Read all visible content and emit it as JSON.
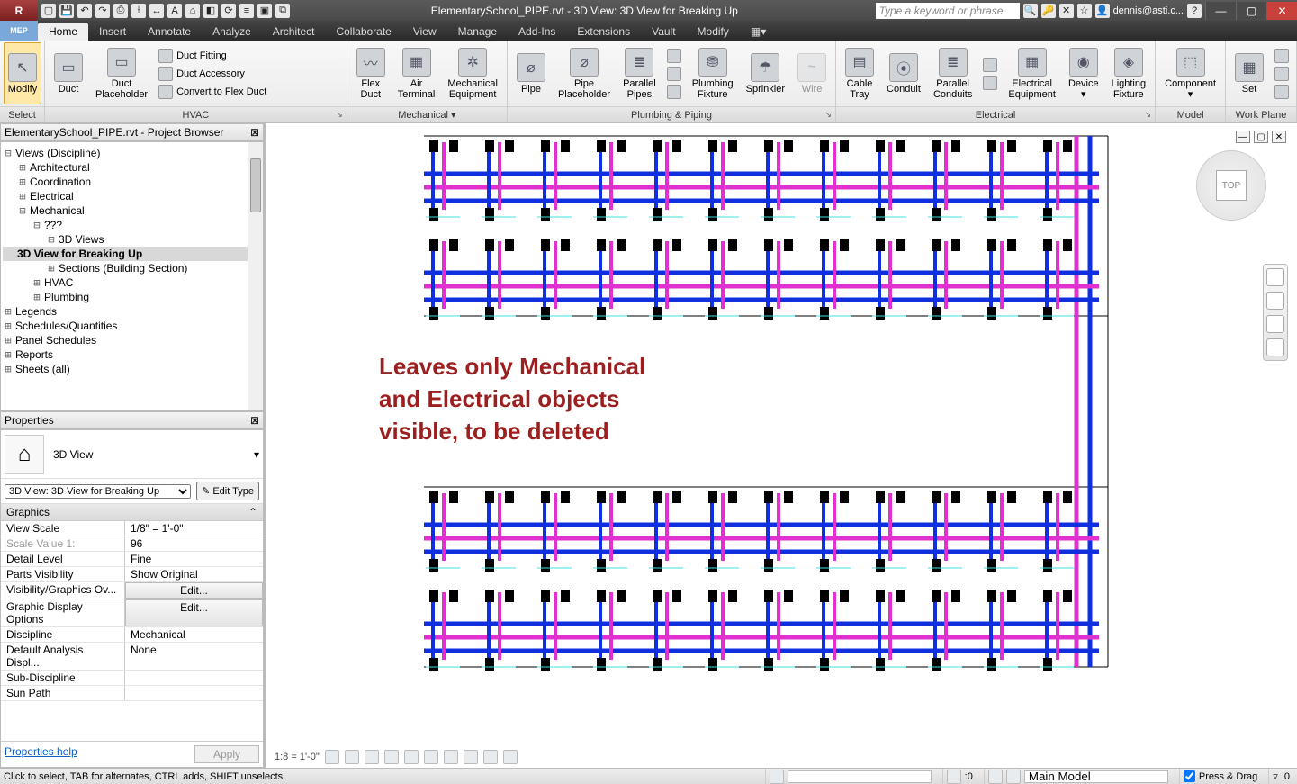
{
  "titlebar": {
    "app_badge": "R",
    "mep_badge": "MEP",
    "document_title": "ElementarySchool_PIPE.rvt - 3D View: 3D View for Breaking Up",
    "search_placeholder": "Type a keyword or phrase",
    "user": "dennis@asti.c...",
    "help_icon": "?"
  },
  "tabs": [
    "Home",
    "Insert",
    "Annotate",
    "Analyze",
    "Architect",
    "Collaborate",
    "View",
    "Manage",
    "Add-Ins",
    "Extensions",
    "Vault",
    "Modify"
  ],
  "active_tab": "Home",
  "ribbon": {
    "panels": [
      {
        "title": "Select",
        "items": [
          {
            "label": "Modify",
            "selected": true
          }
        ]
      },
      {
        "title": "HVAC",
        "items": [
          {
            "label": "Duct"
          },
          {
            "label": "Duct\nPlaceholder"
          }
        ],
        "small": [
          "Duct Fitting",
          "Duct Accessory",
          "Convert to Flex Duct"
        ]
      },
      {
        "title": "Mechanical ▾",
        "items": [
          {
            "label": "Flex\nDuct"
          },
          {
            "label": "Air\nTerminal"
          },
          {
            "label": "Mechanical\nEquipment"
          }
        ]
      },
      {
        "title": "Plumbing & Piping",
        "items": [
          {
            "label": "Pipe"
          },
          {
            "label": "Pipe\nPlaceholder"
          },
          {
            "label": "Parallel\nPipes"
          },
          {
            "label": ""
          },
          {
            "label": "Plumbing\nFixture"
          },
          {
            "label": "Sprinkler"
          },
          {
            "label": "Wire",
            "disabled": true
          }
        ]
      },
      {
        "title": "Electrical",
        "items": [
          {
            "label": "Cable\nTray"
          },
          {
            "label": "Conduit"
          },
          {
            "label": "Parallel\nConduits"
          },
          {
            "label": ""
          },
          {
            "label": "Electrical\nEquipment"
          },
          {
            "label": "Device\n▾"
          },
          {
            "label": "Lighting\nFixture"
          }
        ]
      },
      {
        "title": "Model",
        "items": [
          {
            "label": "Component\n▾"
          }
        ]
      },
      {
        "title": "Work Plane",
        "items": [
          {
            "label": "Set"
          }
        ]
      }
    ]
  },
  "project_browser": {
    "title": "ElementarySchool_PIPE.rvt - Project Browser",
    "tree": [
      {
        "label": "Views (Discipline)",
        "level": 0,
        "exp": "–"
      },
      {
        "label": "Architectural",
        "level": 1,
        "exp": "+"
      },
      {
        "label": "Coordination",
        "level": 1,
        "exp": "+"
      },
      {
        "label": "Electrical",
        "level": 1,
        "exp": "+"
      },
      {
        "label": "Mechanical",
        "level": 1,
        "exp": "–"
      },
      {
        "label": "???",
        "level": 2,
        "exp": "–"
      },
      {
        "label": "3D Views",
        "level": 3,
        "exp": "–"
      },
      {
        "label": "3D View for Breaking Up",
        "level": 4,
        "exp": "",
        "selected": true
      },
      {
        "label": "Sections (Building Section)",
        "level": 3,
        "exp": "+"
      },
      {
        "label": "HVAC",
        "level": 2,
        "exp": "+"
      },
      {
        "label": "Plumbing",
        "level": 2,
        "exp": "+"
      },
      {
        "label": "Legends",
        "level": 0,
        "exp": "+"
      },
      {
        "label": "Schedules/Quantities",
        "level": 0,
        "exp": "+"
      },
      {
        "label": "Panel Schedules",
        "level": 0,
        "exp": "+"
      },
      {
        "label": "Reports",
        "level": 0,
        "exp": "+"
      },
      {
        "label": "Sheets (all)",
        "level": 0,
        "exp": "+"
      }
    ]
  },
  "properties": {
    "title": "Properties",
    "type_name": "3D View",
    "selector": "3D View: 3D View for Breaking Up",
    "edit_type": "Edit Type",
    "group": "Graphics",
    "rows": [
      {
        "name": "View Scale",
        "value": "1/8\" = 1'-0\""
      },
      {
        "name": "Scale Value   1:",
        "value": "96",
        "gray": true
      },
      {
        "name": "Detail Level",
        "value": "Fine"
      },
      {
        "name": "Parts Visibility",
        "value": "Show Original"
      },
      {
        "name": "Visibility/Graphics Ov...",
        "value": "Edit...",
        "btn": true
      },
      {
        "name": "Graphic Display Options",
        "value": "Edit...",
        "btn": true
      },
      {
        "name": "Discipline",
        "value": "Mechanical"
      },
      {
        "name": "Default Analysis Displ...",
        "value": "None"
      },
      {
        "name": "Sub-Discipline",
        "value": ""
      },
      {
        "name": "Sun Path",
        "value": ""
      }
    ],
    "help_link": "Properties help",
    "apply": "Apply"
  },
  "canvas": {
    "annotation_l1": "Leaves only Mechanical",
    "annotation_l2": "and Electrical objects",
    "annotation_l3": "visible, to be deleted",
    "viewcube_top": "TOP",
    "scale_label": "1:8 = 1'-0\""
  },
  "statusbar": {
    "hint": "Click to select, TAB for alternates, CTRL adds, SHIFT unselects.",
    "coord": ":0",
    "workset": "Main Model",
    "press_drag": "Press & Drag",
    "filter": ":0"
  }
}
